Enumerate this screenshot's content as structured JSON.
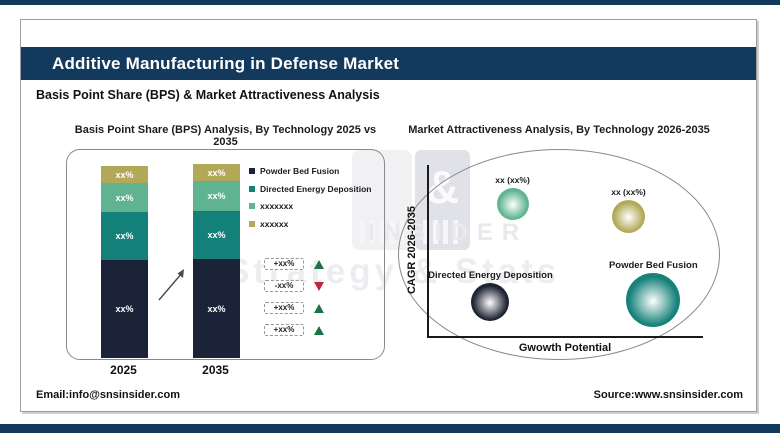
{
  "header": {
    "title": "Additive Manufacturing in Defense Market",
    "subtitle": "Basis Point Share (BPS) & Market Attractiveness Analysis"
  },
  "footer": {
    "email": "Email:info@snsinsider.com",
    "source": "Source:www.snsinsider.com"
  },
  "watermark": {
    "symbol": "&",
    "name": "INSIDER",
    "tagline": "Strategy & Stats"
  },
  "colors": {
    "brand_navy": "#133a5c",
    "bar_navy": "#1b2338",
    "teal": "#14807a",
    "seafoam": "#5fb391",
    "olive": "#b2a958",
    "up_green": "#1a7445",
    "down_red": "#c0273e"
  },
  "chart_data": [
    {
      "type": "bar",
      "stacked": true,
      "title": "Basis Point Share (BPS) Analysis, By Technology 2025 vs 2035",
      "categories": [
        "2025",
        "2035"
      ],
      "series": [
        {
          "name": "Powder Bed Fusion",
          "color": "#1b2338",
          "values": [
            "xx%",
            "xx%"
          ],
          "share_pct": [
            51,
            51
          ]
        },
        {
          "name": "Directed Energy Deposition",
          "color": "#14807a",
          "values": [
            "xx%",
            "xx%"
          ],
          "share_pct": [
            25,
            25
          ]
        },
        {
          "name": "xxxxxxx",
          "color": "#5fb391",
          "values": [
            "xx%",
            "xx%"
          ],
          "share_pct": [
            15,
            15
          ]
        },
        {
          "name": "xxxxxx",
          "color": "#b2a958",
          "values": [
            "xx%",
            "xx%"
          ],
          "share_pct": [
            9,
            9
          ]
        }
      ],
      "changes": [
        {
          "label": "+xx%",
          "direction": "up"
        },
        {
          "label": "-xx%",
          "direction": "down"
        },
        {
          "label": "+xx%",
          "direction": "up"
        },
        {
          "label": "+xx%",
          "direction": "up"
        }
      ]
    },
    {
      "type": "bubble",
      "title": "Market Attractiveness Analysis, By Technology 2026-2035",
      "xlabel": "Gwowth Potential",
      "ylabel": "CAGR 2026-2035",
      "x_axis_meaning": "growth potential (relative, unlabeled)",
      "y_axis_meaning": "CAGR 2026-2035 (relative, unlabeled)",
      "points": [
        {
          "label": "xx (xx%)",
          "color": "#5fb391",
          "x": 31,
          "y": 77,
          "r": 16,
          "emphasis": false
        },
        {
          "label": "xx (xx%)",
          "color": "#b2a958",
          "x": 73,
          "y": 70,
          "r": 16.5,
          "emphasis": false
        },
        {
          "label": "Directed Energy Deposition",
          "color": "#1e2433",
          "x": 23,
          "y": 20,
          "r": 19,
          "emphasis": true
        },
        {
          "label": "Powder Bed Fusion",
          "color": "#17827a",
          "x": 82,
          "y": 21,
          "r": 27,
          "emphasis": true
        }
      ]
    }
  ]
}
